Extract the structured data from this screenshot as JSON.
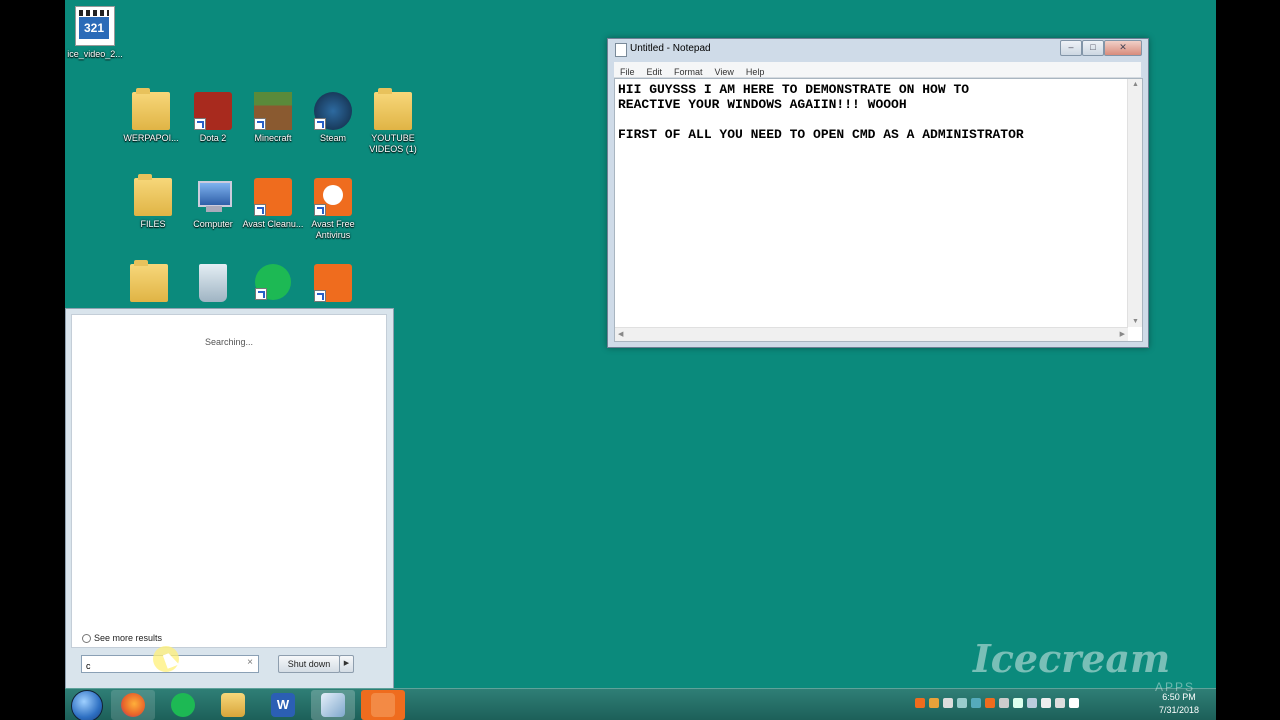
{
  "desktop": {
    "icons": [
      {
        "label": "ice_video_2...",
        "name": "video-file-icon",
        "color": "#ffffff"
      },
      {
        "label": "WERPAPOI...",
        "name": "folder-icon",
        "color": "#e8c25c"
      },
      {
        "label": "Dota 2",
        "name": "dota-icon",
        "color": "#a82a1e"
      },
      {
        "label": "Minecraft",
        "name": "minecraft-icon",
        "color": "#5a8a3a"
      },
      {
        "label": "Steam",
        "name": "steam-icon",
        "color": "#1b4a7a"
      },
      {
        "label": "YOUTUBE VIDEOS (1)",
        "name": "folder-icon",
        "color": "#e8c25c"
      },
      {
        "label": "FILES",
        "name": "folder-icon",
        "color": "#e8c25c"
      },
      {
        "label": "Computer",
        "name": "computer-icon",
        "color": "#5a8ac8"
      },
      {
        "label": "Avast Cleanu...",
        "name": "avast-cleanup-icon",
        "color": "#ef6c1e"
      },
      {
        "label": "Avast Free Antivirus",
        "name": "avast-antivirus-icon",
        "color": "#ef6c1e"
      },
      {
        "label": "",
        "name": "folder-icon",
        "color": "#e8c25c"
      },
      {
        "label": "",
        "name": "recycle-bin-icon",
        "color": "#b8c8d4"
      },
      {
        "label": "",
        "name": "spotify-icon",
        "color": "#1db954"
      },
      {
        "label": "",
        "name": "screenshot-app-icon",
        "color": "#ef6c1e"
      }
    ]
  },
  "notepad": {
    "title": "Untitled - Notepad",
    "menu": [
      "File",
      "Edit",
      "Format",
      "View",
      "Help"
    ],
    "text": "HII GUYSSS I AM HERE TO DEMONSTRATE ON HOW TO\nREACTIVE YOUR WINDOWS AGAIIN!!! WOOOH\n\nFIRST OF ALL YOU NEED TO OPEN CMD AS A ADMINISTRATOR",
    "buttons": {
      "minimize": "–",
      "maximize": "□",
      "close": "✕"
    }
  },
  "start_menu": {
    "status": "Searching...",
    "see_more": "See more results",
    "search_value": "c",
    "clear_glyph": "×",
    "shutdown_label": "Shut down",
    "shutdown_arrow": "▶"
  },
  "taskbar": {
    "apps": [
      {
        "name": "firefox-icon",
        "color": "#e8632a"
      },
      {
        "name": "spotify-icon",
        "color": "#1db954"
      },
      {
        "name": "file-explorer-icon",
        "color": "#e8c25c"
      },
      {
        "name": "word-icon",
        "color": "#2b5fb4"
      },
      {
        "name": "notepad-icon",
        "color": "#9fc2e0"
      },
      {
        "name": "screenshot-app-icon",
        "color": "#ef6c1e"
      }
    ],
    "clock_time": "6:50 PM",
    "clock_date": "7/31/2018"
  },
  "watermark": {
    "text": "Icecream",
    "sub": "APPS"
  }
}
